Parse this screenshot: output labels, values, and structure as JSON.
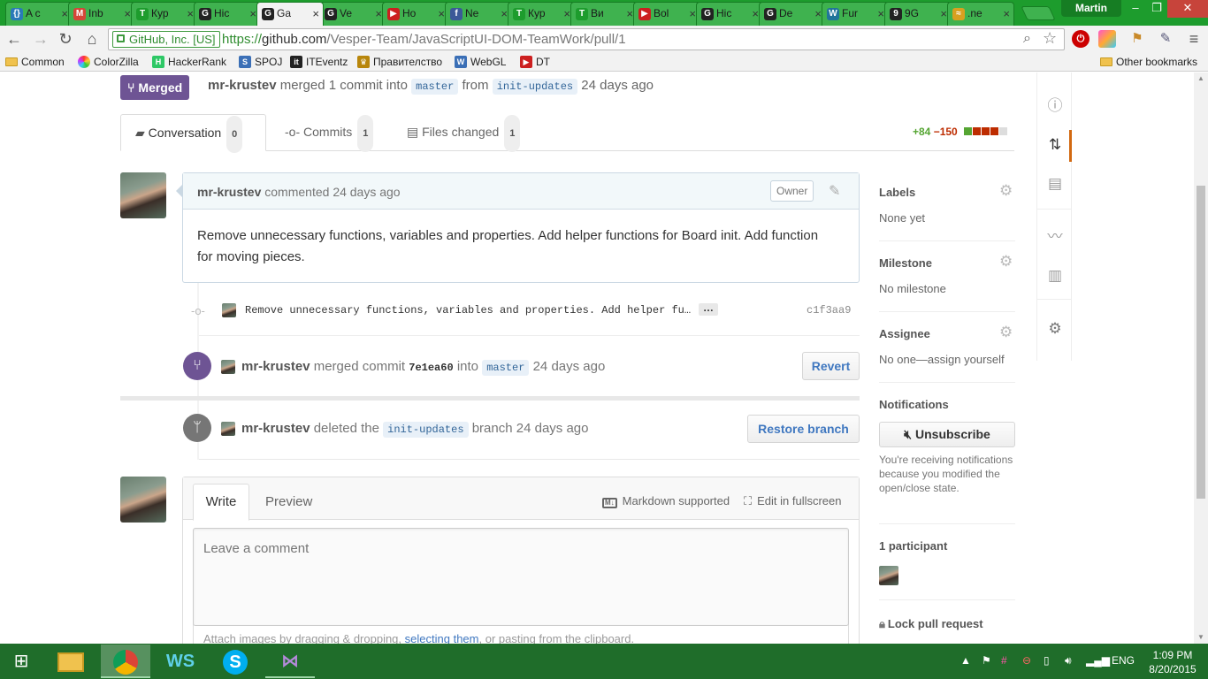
{
  "window": {
    "profile": "Martin"
  },
  "tabs": [
    {
      "label": "A c",
      "icon": "code-braces-icon",
      "color": "#2a7ab8",
      "glyph": "{}"
    },
    {
      "label": "Inb",
      "icon": "gmail-icon",
      "color": "#d44638",
      "glyph": "M"
    },
    {
      "label": "Кур",
      "icon": "telerik-icon",
      "color": "#1d9c2d",
      "glyph": "T"
    },
    {
      "label": "Hic",
      "icon": "github-icon",
      "color": "#222222",
      "glyph": "G"
    },
    {
      "label": "Ga",
      "icon": "github-icon",
      "color": "#222222",
      "glyph": "G",
      "active": true
    },
    {
      "label": "Ve",
      "icon": "github-icon",
      "color": "#222222",
      "glyph": "G"
    },
    {
      "label": "Ho",
      "icon": "youtube-icon",
      "color": "#cc1f1f",
      "glyph": "▶"
    },
    {
      "label": "Ne",
      "icon": "facebook-icon",
      "color": "#3b5998",
      "glyph": "f"
    },
    {
      "label": "Кур",
      "icon": "telerik-icon",
      "color": "#1d9c2d",
      "glyph": "T"
    },
    {
      "label": "Ви",
      "icon": "telerik-icon",
      "color": "#1d9c2d",
      "glyph": "T"
    },
    {
      "label": "Bol",
      "icon": "youtube-icon",
      "color": "#cc1f1f",
      "glyph": "▶"
    },
    {
      "label": "Hic",
      "icon": "github-icon",
      "color": "#222222",
      "glyph": "G"
    },
    {
      "label": "De",
      "icon": "github-icon",
      "color": "#222222",
      "glyph": "G"
    },
    {
      "label": "Fur",
      "icon": "wordpress-icon",
      "color": "#21759b",
      "glyph": "W"
    },
    {
      "label": "9G",
      "icon": "9gag-icon",
      "color": "#222222",
      "glyph": "9"
    },
    {
      "label": ".ne",
      "icon": "dotnet-icon",
      "color": "#d8a020",
      "glyph": "≈"
    }
  ],
  "address": {
    "ev_label": "GitHub, Inc. [US]",
    "url_scheme": "https://",
    "url_host": "github.com",
    "url_path": "/Vesper-Team/JavaScriptUI-DOM-TeamWork/pull/1"
  },
  "bookmarks": [
    {
      "label": "Common",
      "icon": "folder-icon"
    },
    {
      "label": "ColorZilla",
      "icon": "colorzilla-icon",
      "color": "#e33"
    },
    {
      "label": "HackerRank",
      "icon": "hackerrank-icon",
      "color": "#2ec866",
      "glyph": "H"
    },
    {
      "label": "SPOJ",
      "icon": "spoj-icon",
      "color": "#3b6fb6",
      "glyph": "S"
    },
    {
      "label": "ITEventz",
      "icon": "iteventz-icon",
      "color": "#222",
      "glyph": "it"
    },
    {
      "label": "Правителство",
      "icon": "government-icon",
      "color": "#b8860b",
      "glyph": "♛"
    },
    {
      "label": "WebGL",
      "icon": "webgl-icon",
      "color": "#3b6fb6",
      "glyph": "W"
    },
    {
      "label": "DT",
      "icon": "youtube-icon",
      "color": "#cc1f1f",
      "glyph": "▶"
    }
  ],
  "other_bookmarks": "Other bookmarks",
  "pr": {
    "state": "Merged",
    "author": "mr-krustev",
    "merge_text": "merged 1 commit into",
    "base_branch": "master",
    "from_text": "from",
    "head_branch": "init-updates",
    "age": "24 days ago"
  },
  "pr_tabs": [
    {
      "label": "Conversation",
      "count": "0"
    },
    {
      "label": "Commits",
      "count": "1"
    },
    {
      "label": "Files changed",
      "count": "1"
    }
  ],
  "diffstat": {
    "additions": "+84",
    "deletions": "−150"
  },
  "comment": {
    "author": "mr-krustev",
    "action": "commented",
    "age": "24 days ago",
    "badge": "Owner",
    "body": "Remove unnecessary functions, variables and properties. Add helper functions for Board init. Add function for moving pieces."
  },
  "commit": {
    "message": "Remove unnecessary functions, variables and properties. Add helper fu…",
    "ellipsis": "…",
    "sha": "c1f3aa9"
  },
  "merge_event": {
    "author": "mr-krustev",
    "text1": "merged commit",
    "sha": "7e1ea60",
    "text2": "into",
    "branch": "master",
    "age": "24 days ago",
    "button": "Revert"
  },
  "delete_event": {
    "author": "mr-krustev",
    "text1": "deleted the",
    "branch": "init-updates",
    "text2": "branch",
    "age": "24 days ago",
    "button": "Restore branch"
  },
  "composer": {
    "tab_write": "Write",
    "tab_preview": "Preview",
    "markdown": "Markdown supported",
    "fullscreen": "Edit in fullscreen",
    "placeholder": "Leave a comment",
    "attach_prefix": "Attach images by dragging & dropping,",
    "attach_link": "selecting them",
    "attach_suffix": ", or pasting from the clipboard."
  },
  "sidebar": {
    "labels_title": "Labels",
    "labels_value": "None yet",
    "milestone_title": "Milestone",
    "milestone_value": "No milestone",
    "assignee_title": "Assignee",
    "assignee_value": "No one—assign yourself",
    "notifications_title": "Notifications",
    "unsubscribe": "Unsubscribe",
    "notifications_reason": "You're receiving notifications because you modified the open/close state.",
    "participants": "1 participant",
    "lock": "Lock pull request"
  },
  "taskbar": {
    "language": "ENG",
    "time": "1:09 PM",
    "date": "8/20/2015"
  },
  "colors": {
    "tab_green": "#1d9c2d",
    "merged_purple": "#6e5494",
    "link_blue": "#4078c0",
    "add_green": "#55a532",
    "del_red": "#bd2c00",
    "taskbar": "#1f6d2a"
  }
}
